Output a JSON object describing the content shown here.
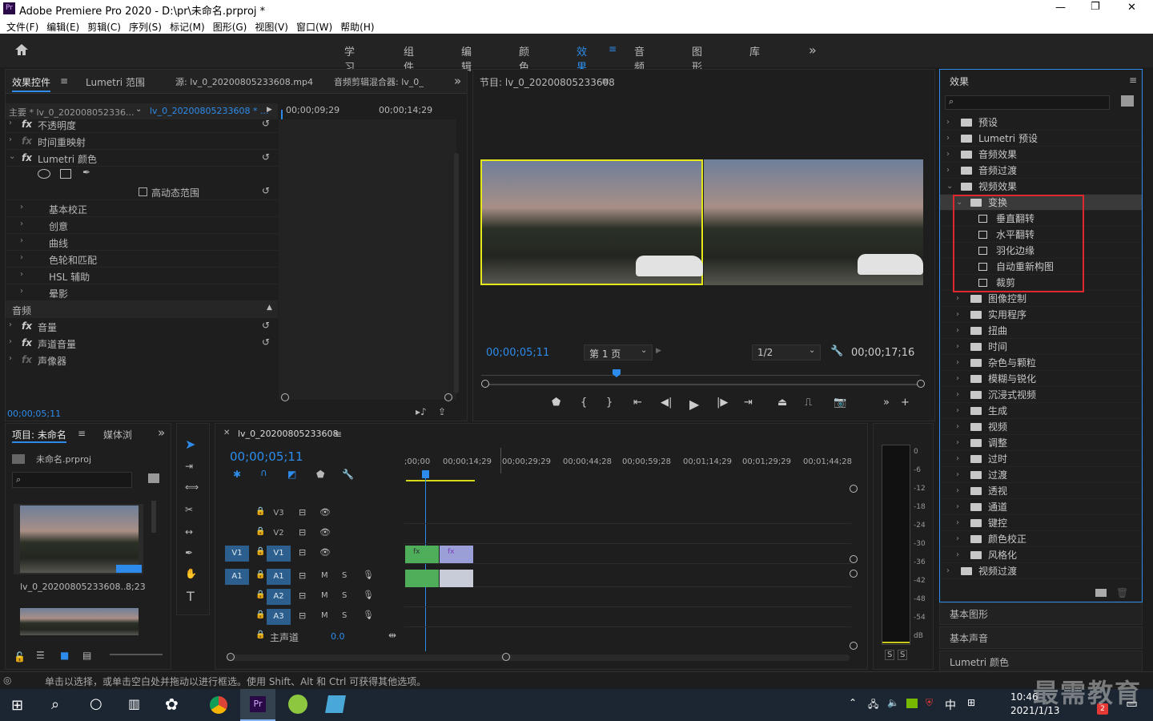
{
  "window": {
    "title": "Adobe Premiere Pro 2020 - D:\\pr\\未命名.prproj *",
    "minimize": "—",
    "maximize": "❐",
    "close": "✕",
    "app_icon": "Pr"
  },
  "menu": [
    "文件(F)",
    "编辑(E)",
    "剪辑(C)",
    "序列(S)",
    "标记(M)",
    "图形(G)",
    "视图(V)",
    "窗口(W)",
    "帮助(H)"
  ],
  "workspaces": {
    "tabs": [
      "学习",
      "组件",
      "编辑",
      "颜色",
      "效果",
      "音频",
      "图形",
      "库"
    ],
    "active": "效果",
    "menu_glyph": "≡",
    "more": "»"
  },
  "effect_controls": {
    "tabs": [
      "效果控件",
      "Lumetri 范围",
      "源: lv_0_20200805233608.mp4",
      "音频剪辑混合器: lv_0_"
    ],
    "source_master": "主要 * lv_0_202008052336...",
    "sequence_clip": "lv_0_20200805233608 * ...",
    "ruler": [
      "00;00;09;29",
      "00;00;14;29"
    ],
    "rows": [
      {
        "label": "不透明度",
        "fx": true
      },
      {
        "label": "时间重映射",
        "fx": true,
        "dim": true
      },
      {
        "label": "Lumetri 颜色",
        "fx": true,
        "reset": true
      },
      {
        "label": "高动态范围",
        "checkbox": true
      },
      {
        "label": "基本校正"
      },
      {
        "label": "创意"
      },
      {
        "label": "曲线"
      },
      {
        "label": "色轮和匹配"
      },
      {
        "label": "HSL 辅助"
      },
      {
        "label": "晕影"
      }
    ],
    "audio_header": "音频",
    "audio_rows": [
      {
        "label": "音量",
        "fx": true
      },
      {
        "label": "声道音量",
        "fx": true
      },
      {
        "label": "声像器",
        "fx": true,
        "dim": true
      }
    ],
    "timecode": "00;00;05;11"
  },
  "program": {
    "title": "节目: lv_0_20200805233608",
    "timecode": "00;00;05;11",
    "page": "第 1 页",
    "fraction": "1/2",
    "duration": "00;00;17;16"
  },
  "effects": {
    "title": "效果",
    "search_placeholder": "",
    "tree": [
      {
        "label": "预设",
        "level": 0,
        "open": false
      },
      {
        "label": "Lumetri 预设",
        "level": 0,
        "open": false
      },
      {
        "label": "音频效果",
        "level": 0,
        "open": false
      },
      {
        "label": "音频过渡",
        "level": 0,
        "open": false
      },
      {
        "label": "视频效果",
        "level": 0,
        "open": true
      },
      {
        "label": "变换",
        "level": 1,
        "open": true,
        "selected": true
      },
      {
        "label": "垂直翻转",
        "level": 2,
        "item": true
      },
      {
        "label": "水平翻转",
        "level": 2,
        "item": true
      },
      {
        "label": "羽化边缘",
        "level": 2,
        "item": true
      },
      {
        "label": "自动重新构图",
        "level": 2,
        "item": true
      },
      {
        "label": "裁剪",
        "level": 2,
        "item": true
      },
      {
        "label": "图像控制",
        "level": 1
      },
      {
        "label": "实用程序",
        "level": 1
      },
      {
        "label": "扭曲",
        "level": 1
      },
      {
        "label": "时间",
        "level": 1
      },
      {
        "label": "杂色与颗粒",
        "level": 1
      },
      {
        "label": "模糊与锐化",
        "level": 1
      },
      {
        "label": "沉浸式视频",
        "level": 1
      },
      {
        "label": "生成",
        "level": 1
      },
      {
        "label": "视频",
        "level": 1
      },
      {
        "label": "调整",
        "level": 1
      },
      {
        "label": "过时",
        "level": 1
      },
      {
        "label": "过渡",
        "level": 1
      },
      {
        "label": "透视",
        "level": 1
      },
      {
        "label": "通道",
        "level": 1
      },
      {
        "label": "键控",
        "level": 1
      },
      {
        "label": "颜色校正",
        "level": 1
      },
      {
        "label": "风格化",
        "level": 1
      },
      {
        "label": "视频过渡",
        "level": 0,
        "open": false
      }
    ],
    "highlight_color": "#e0272f",
    "bottom_panels": [
      "基本图形",
      "基本声音",
      "Lumetri 颜色"
    ]
  },
  "project": {
    "tabs": [
      "项目: 未命名",
      "媒体浏"
    ],
    "file": "未命名.prproj",
    "clip_name": "lv_0_20200805233608...",
    "clip_duration": "8;23"
  },
  "timeline": {
    "tab": "lv_0_20200805233608",
    "timecode": "00;00;05;11",
    "ruler": [
      ";00;00",
      "00;00;14;29",
      "00;00;29;29",
      "00;00;44;28",
      "00;00;59;28",
      "00;01;14;29",
      "00;01;29;29",
      "00;01;44;28"
    ],
    "video_tracks": [
      "V3",
      "V2",
      "V1"
    ],
    "audio_tracks": [
      "A1",
      "A2",
      "A3"
    ],
    "master_label": "主声道",
    "master_value": "0.0",
    "source_v": "V1",
    "source_a": "A1",
    "fx_label": "fx"
  },
  "meter": {
    "scale": [
      "0",
      "-6",
      "-12",
      "-18",
      "-24",
      "-30",
      "-36",
      "-42",
      "-48",
      "-54",
      "dB"
    ],
    "solo": [
      "S",
      "S"
    ]
  },
  "status": "单击以选择，或单击空白处并拖动以进行框选。使用 Shift、Alt 和 Ctrl 可获得其他选项。",
  "taskbar": {
    "time": "10:46",
    "date": "2021/1/13",
    "lang": "中",
    "badge": "2",
    "pr_label": "Pr"
  },
  "watermark": "最需教育"
}
